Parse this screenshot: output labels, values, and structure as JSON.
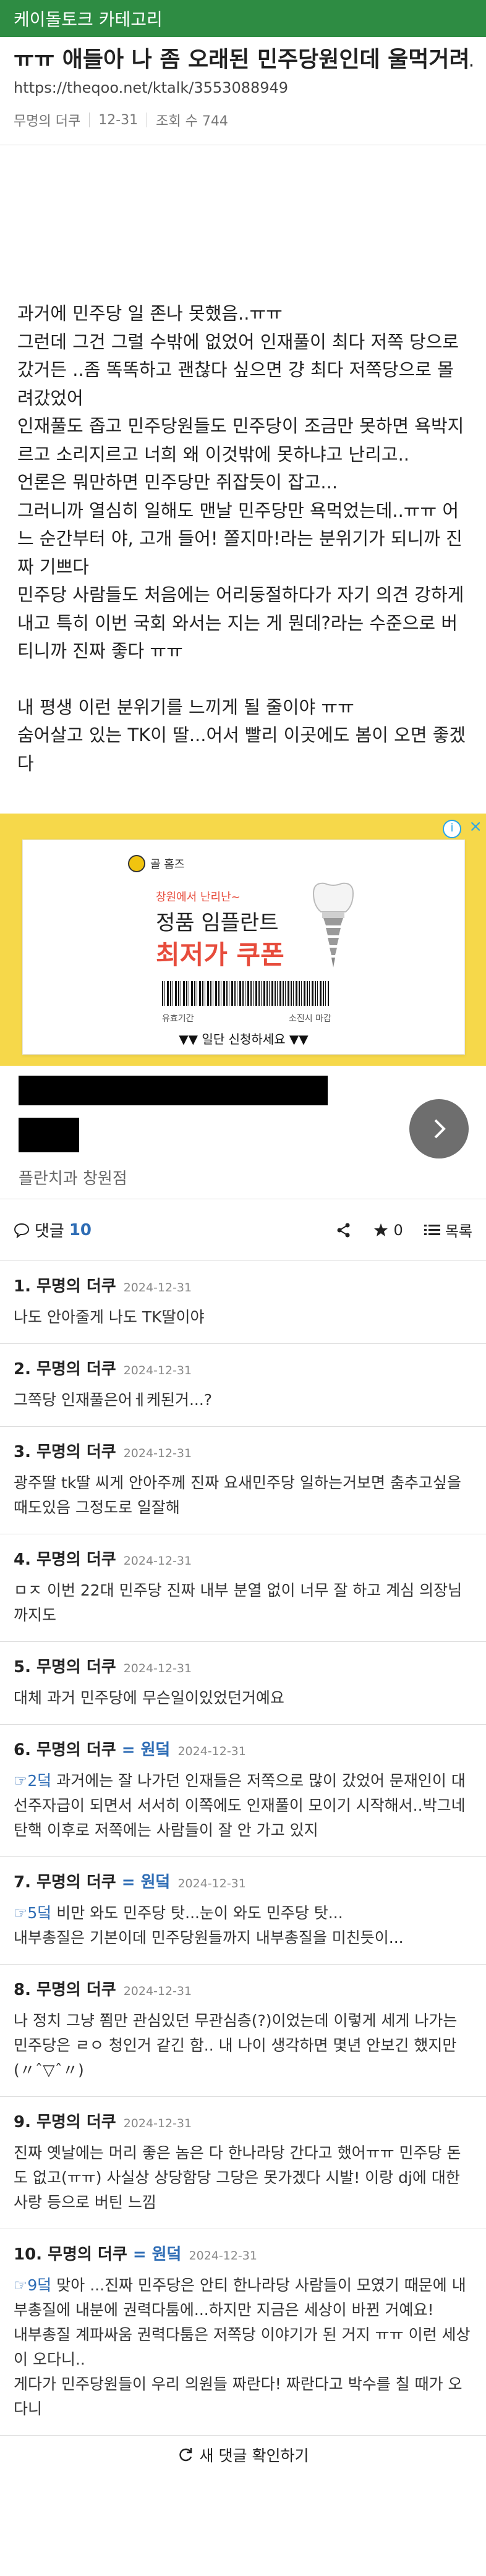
{
  "category_bar": "케이돌토크 카테고리",
  "post": {
    "title": "ㅠㅠ 애들아 나 좀 오래된 민주당원인데 울먹거려도 되냐......",
    "url": "https://theqoo.net/ktalk/3553088949",
    "author": "무명의 더쿠",
    "date": "12-31",
    "views": "조회 수 744",
    "body": [
      "과거에 민주당 일 존나 못했음..ㅠㅠ",
      "그런데 그건 그럴 수밖에 없었어 인재풀이 최다 저쪽 당으로 갔거든 ..좀 똑똑하고 괜찮다 싶으면 걍 최다 저쪽당으로 몰려갔었어",
      "인재풀도 좁고 민주당원들도 민주당이 조금만 못하면 욕박지르고 소리지르고 너희 왜 이것밖에 못하냐고 난리고..",
      "언론은 뭐만하면 민주당만 쥐잡듯이 잡고...",
      "그러니까 열심히 일해도 맨날 민주당만 욕먹었는데..ㅠㅠ 어느 순간부터 야, 고개 들어! 쫄지마!라는 분위기가 되니까 진짜 기쁘다",
      "민주당 사람들도 처음에는 어리둥절하다가 자기 의견 강하게 내고 특히 이번 국회 와서는 지는 게 뭔데?라는 수준으로 버티니까 진짜 좋다 ㅠㅠ",
      "",
      "내 평생 이런 분위기를 느끼게 될 줄이야 ㅠㅠ",
      "숨어살고 있는 TK이 딸...어서 빨리 이곳에도 봄이 오면 좋겠다"
    ]
  },
  "ad": {
    "info": "i",
    "close": "×",
    "brand": "골 홈즈",
    "promo_small": "창원에서 난리난~",
    "product": "정품 임플란트",
    "price": "최저가 쿠폰",
    "valid_label": "유효기간",
    "issuer_label": "소진시 마감",
    "apply": "▼▼ 일단 신청하세요 ▼▼",
    "place": "플란치과 창원점"
  },
  "comments_bar": {
    "label": "댓글",
    "count": "10",
    "likes": "0",
    "list": "목록"
  },
  "comments": [
    {
      "num": "1.",
      "author": "무명의 더쿠",
      "op": "",
      "date": "2024-12-31",
      "reply": "",
      "text": "나도 안아줄게 나도 TK딸이야"
    },
    {
      "num": "2.",
      "author": "무명의 더쿠",
      "op": "",
      "date": "2024-12-31",
      "reply": "",
      "text": "그쪽당 인재풀은어ㅔ케된거...?"
    },
    {
      "num": "3.",
      "author": "무명의 더쿠",
      "op": "",
      "date": "2024-12-31",
      "reply": "",
      "text": "광주딸 tk딸 씨게 안아주께 진짜 요새민주당 일하는거보면 춤추고싶을 때도있음 그정도로 일잘해"
    },
    {
      "num": "4.",
      "author": "무명의 더쿠",
      "op": "",
      "date": "2024-12-31",
      "reply": "",
      "text": "ㅁㅈ 이번 22대 민주당 진짜 내부 분열 없이 너무 잘 하고 계심 의장님까지도"
    },
    {
      "num": "5.",
      "author": "무명의 더쿠",
      "op": "",
      "date": "2024-12-31",
      "reply": "",
      "text": "대체 과거 민주당에 무슨일이있었던거예요"
    },
    {
      "num": "6.",
      "author": "무명의 더쿠",
      "op": "= 원덬",
      "date": "2024-12-31",
      "reply": "☞2덬",
      "text": " 과거에는 잘 나가던 인재들은 저쪽으로 많이 갔었어 문재인이 대선주자급이 되면서 서서히 이쪽에도 인재풀이 모이기 시작해서..박그네 탄핵 이후로 저쪽에는 사람들이 잘 안 가고 있지"
    },
    {
      "num": "7.",
      "author": "무명의 더쿠",
      "op": "= 원덬",
      "date": "2024-12-31",
      "reply": "☞5덬",
      "text": " 비만 와도 민주당 탓...눈이 와도 민주당 탓...\n내부총질은 기본이데 민주당원들까지 내부총질을 미친듯이..."
    },
    {
      "num": "8.",
      "author": "무명의 더쿠",
      "op": "",
      "date": "2024-12-31",
      "reply": "",
      "text": "나 정치 그냥 쬠만 관심있던 무관심층(?)이었는데 이렇게 세게 나가는 민주당은 ㄹㅇ 청인거 같긴 함.. 내 나이 생각하면 몇년 안보긴 했지만 (〃ˆ▽ˆ〃)"
    },
    {
      "num": "9.",
      "author": "무명의 더쿠",
      "op": "",
      "date": "2024-12-31",
      "reply": "",
      "text": "진짜 옛날에는 머리 좋은 놈은 다 한나라당 간다고 했어ㅠㅠ 민주당 돈도 없고(ㅠㅠ) 사실상 상당함당 그당은 못가겠다 시발! 이랑 dj에 대한 사랑 등으로 버틴 느낌"
    },
    {
      "num": "10.",
      "author": "무명의 더쿠",
      "op": "= 원덬",
      "date": "2024-12-31",
      "reply": "☞9덬",
      "text": " 맞아 ...진짜 민주당은 안티 한나라당 사람들이 모였기 때문에 내부총질에 내분에 권력다툼에...하지만 지금은 세상이 바뀐 거예요!\n내부총질 계파싸움 권력다툼은 저쪽당 이야기가 된 거지 ㅠㅠ 이런 세상이 오다니..\n게다가 민주당원들이 우리 의원들 짜란다! 짜란다고 박수를 칠 때가 오다니"
    }
  ],
  "refresh": "새 댓글 확인하기"
}
